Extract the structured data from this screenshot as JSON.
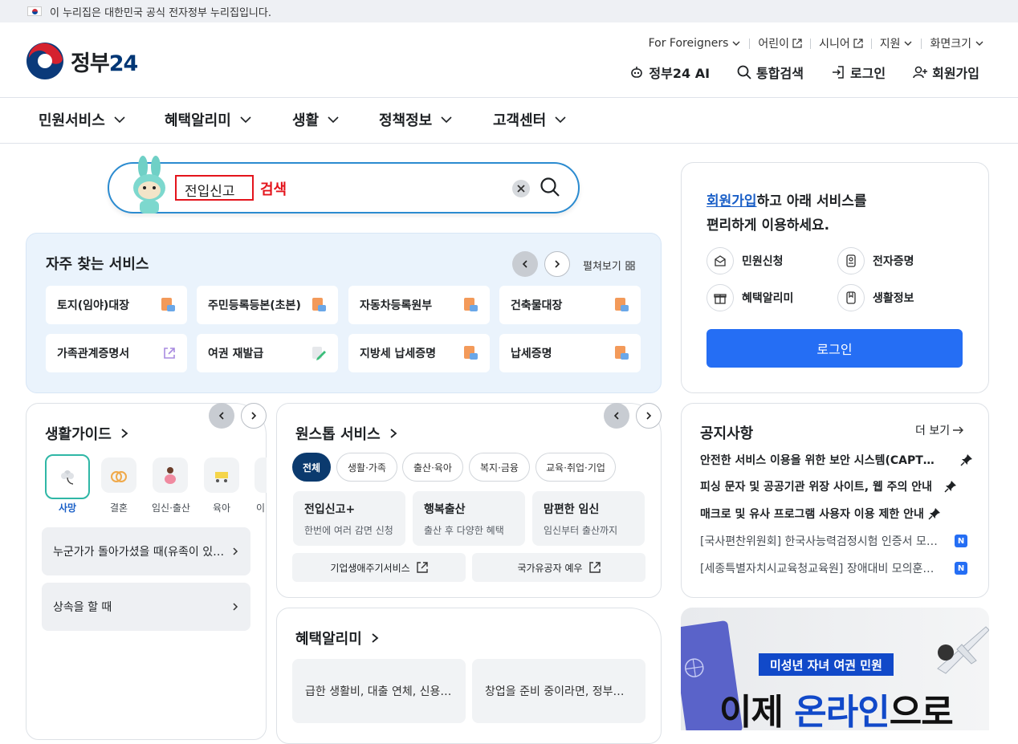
{
  "notice": {
    "text": "이 누리집은 대한민국 공식 전자정부 누리집입니다."
  },
  "logo": {
    "text": "정부",
    "num": "24"
  },
  "util": {
    "foreigners": "For Foreigners",
    "kids": "어린이",
    "senior": "시니어",
    "support": "지원",
    "fontsize": "화면크기"
  },
  "gnb": {
    "ai": "정부24 AI",
    "search": "통합검색",
    "login": "로그인",
    "join": "회원가입"
  },
  "mainnav": [
    "민원서비스",
    "혜택알리미",
    "생활",
    "정책정보",
    "고객센터"
  ],
  "search": {
    "value": "전입신고",
    "label": "검색"
  },
  "frequent": {
    "title": "자주 찾는 서비스",
    "expand": "펼쳐보기",
    "items": [
      "토지(임야)대장",
      "주민등록등본(초본)",
      "자동차등록원부",
      "건축물대장",
      "가족관계증명서",
      "여권 재발급",
      "지방세 납세증명",
      "납세증명"
    ]
  },
  "guide": {
    "title": "생활가이드",
    "cats": [
      "사망",
      "결혼",
      "임신·출산",
      "육아",
      "이"
    ],
    "items": [
      "누군가가 돌아가셨을 때(유족이 있…",
      "상속을 할 때"
    ]
  },
  "onestop": {
    "title": "원스톱 서비스",
    "chips": [
      "전체",
      "생활·가족",
      "출산·육아",
      "복지·금융",
      "교육·취업·기업"
    ],
    "cards": [
      {
        "title": "전입신고+",
        "desc": "한번에 여러 감면 신청"
      },
      {
        "title": "행복출산",
        "desc": "출산 후 다양한 혜택"
      },
      {
        "title": "맘편한 임신",
        "desc": "임신부터 출산까지"
      }
    ],
    "links": [
      "기업생애주기서비스",
      "국가유공자 예우"
    ]
  },
  "benefit": {
    "title": "혜택알리미",
    "cards": [
      "급한 생활비, 대출 연체, 신용…",
      "창업을 준비 중이라면, 정부…"
    ]
  },
  "loginPanel": {
    "highlight": "회원가입",
    "line1": "하고 아래 서비스를",
    "line2": "편리하게 이용하세요.",
    "services": [
      "민원신청",
      "전자증명",
      "혜택알리미",
      "생활정보"
    ],
    "button": "로그인"
  },
  "notices": {
    "title": "공지사항",
    "more": "더 보기",
    "items": [
      "안전한 서비스 이용을 위한 보안 시스템(CAPTCHA) 도입 안내",
      "피싱 문자 및 공공기관 위장 사이트, 웹 주의 안내",
      "매크로 및 유사 프로그램 사용자 이용 제한 안내",
      "[국사편찬위원회] 한국사능력검정시험 인증서 모…",
      "[세종특별자치시교육청교육원] 장애대비 모의훈…"
    ],
    "badge": "N"
  },
  "banner": {
    "tag": "미성년 자녀 여권 민원",
    "main_a": "이제 ",
    "main_b": "온라인",
    "main_c": "으로"
  },
  "colors": {
    "primary": "#256ef4",
    "navy": "#0b3a6e",
    "accent_red": "#e4141c",
    "freq_bg": "#eaf3fc"
  }
}
